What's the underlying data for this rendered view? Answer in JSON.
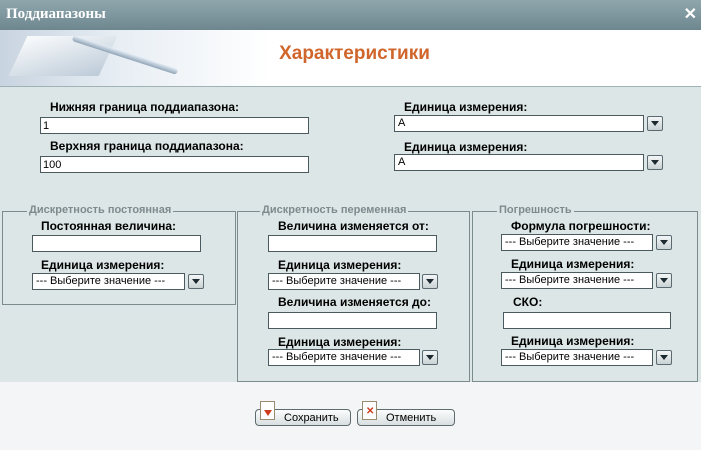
{
  "window": {
    "title": "Поддиапазоны",
    "close_glyph": "✕"
  },
  "header": {
    "heading": "Характеристики"
  },
  "top": {
    "lower_label": "Нижняя граница поддиапазона:",
    "lower_value": "1",
    "upper_label": "Верхняя граница поддиапазона:",
    "upper_value": "100",
    "unit1_label": "Единица измерения:",
    "unit1_value": "А",
    "unit2_label": "Единица измерения:",
    "unit2_value": "А"
  },
  "fixed": {
    "legend": "Дискретность постоянная",
    "constant_label": "Постоянная величина:",
    "constant_value": "",
    "unit_label": "Единица измерения:",
    "unit_value": "--- Выберите значение ---"
  },
  "variable": {
    "legend": "Дискретность переменная",
    "from_label": "Величина изменяется от:",
    "from_value": "",
    "unit_from_label": "Единица измерения:",
    "unit_from_value": "--- Выберите значение ---",
    "to_label": "Величина изменяется до:",
    "to_value": "",
    "unit_to_label": "Единица измерения:",
    "unit_to_value": "--- Выберите значение ---"
  },
  "error": {
    "legend": "Погрешность",
    "formula_label": "Формула погрешности:",
    "formula_value": "--- Выберите значение ---",
    "unit1_label": "Единица измерения:",
    "unit1_value": "--- Выберите значение ---",
    "sko_label": "СКО:",
    "sko_value": "",
    "unit2_label": "Единица измерения:",
    "unit2_value": "--- Выберите значение ---"
  },
  "buttons": {
    "save": "Сохранить",
    "cancel": "Отменить"
  },
  "colors": {
    "heading": "#d0662c",
    "panel": "#dde6e6",
    "titlebar": "#7a9199"
  }
}
